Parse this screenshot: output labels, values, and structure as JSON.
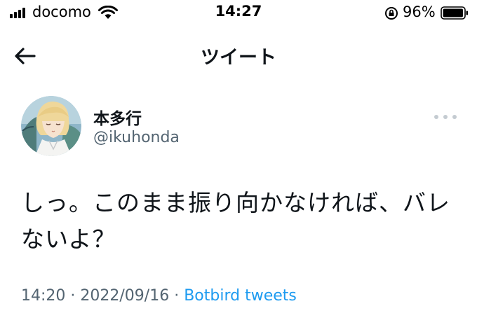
{
  "status_bar": {
    "carrier": "docomo",
    "time": "14:27",
    "battery_percent": "96%",
    "icons": [
      "signal-icon",
      "wifi-icon",
      "orientation-lock-icon",
      "battery-icon"
    ]
  },
  "header": {
    "title": "ツイート",
    "back_icon": "back-arrow-icon"
  },
  "tweet": {
    "author_name": "本多行",
    "author_handle": "@ikuhonda",
    "text": "しっ。このまま振り向かなければ、バレないよ？",
    "time": "14:20",
    "separator": "·",
    "date": "2022/09/16",
    "source": "Botbird tweets"
  },
  "colors": {
    "text_primary": "#0f1419",
    "text_secondary": "#536471",
    "link": "#1d9bf0"
  }
}
